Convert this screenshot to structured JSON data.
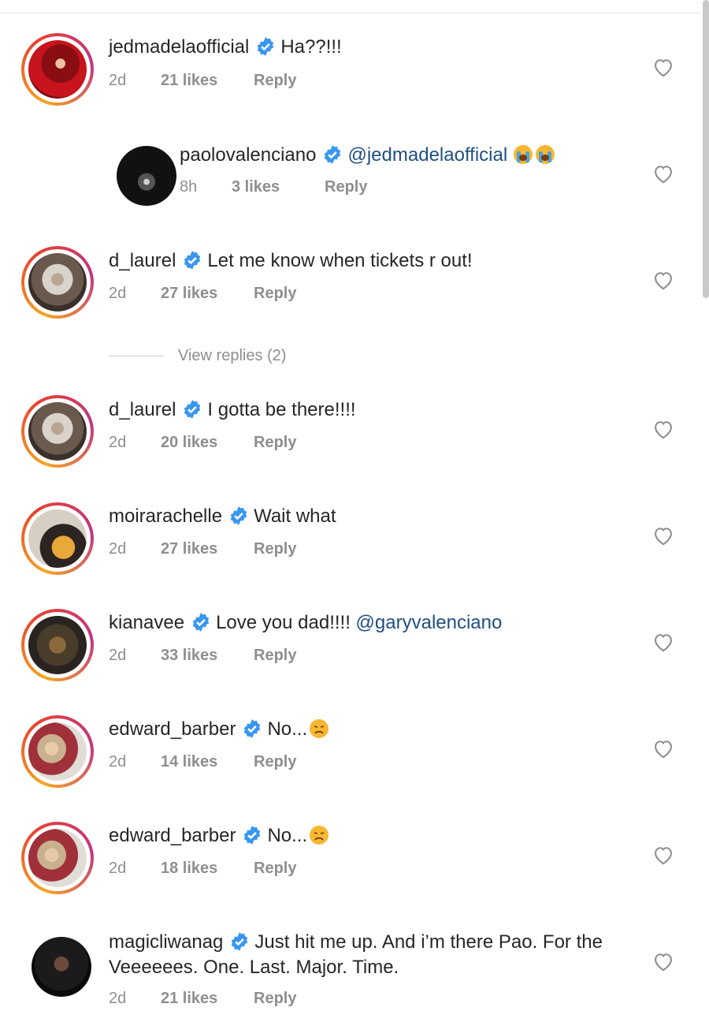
{
  "comments": [
    {
      "username": "jedmadelaofficial",
      "text": "Ha??!!!",
      "mention": "",
      "time": "2d",
      "likes": "21 likes",
      "reply": "Reply"
    },
    {
      "username": "paolovalenciano",
      "text": "",
      "mention": "@jedmadelaofficial",
      "time": "8h",
      "likes": "3 likes",
      "reply": "Reply"
    },
    {
      "username": "d_laurel",
      "text": "Let me know when tickets r out!",
      "mention": "",
      "time": "2d",
      "likes": "27 likes",
      "reply": "Reply"
    },
    {
      "username": "d_laurel",
      "text": "I gotta be there!!!!",
      "mention": "",
      "time": "2d",
      "likes": "20 likes",
      "reply": "Reply"
    },
    {
      "username": "moirarachelle",
      "text": "Wait what",
      "mention": "",
      "time": "2d",
      "likes": "27 likes",
      "reply": "Reply"
    },
    {
      "username": "kianavee",
      "text": "Love you dad!!!! ",
      "mention": "@garyvalenciano",
      "time": "2d",
      "likes": "33 likes",
      "reply": "Reply"
    },
    {
      "username": "edward_barber",
      "text": "No...",
      "mention": "",
      "time": "2d",
      "likes": "14 likes",
      "reply": "Reply"
    },
    {
      "username": "edward_barber",
      "text": "No...",
      "mention": "",
      "time": "2d",
      "likes": "18 likes",
      "reply": "Reply"
    },
    {
      "username": "magicliwanag",
      "text": "Just hit me up. And i’m there Pao. For the Veeeeees. One. Last. Major. Time.",
      "mention": "",
      "time": "2d",
      "likes": "21 likes",
      "reply": "Reply"
    }
  ],
  "view_replies": "View replies (2)",
  "colors": {
    "verified": "#3897f0",
    "muted": "#8e8e8e",
    "mention": "#1f4f82"
  },
  "icons": {
    "verified": "verified-badge-icon",
    "heart": "heart-outline-icon",
    "emoji_crying": "loudly-crying-face-emoji",
    "emoji_disappointed": "disappointed-face-emoji"
  }
}
